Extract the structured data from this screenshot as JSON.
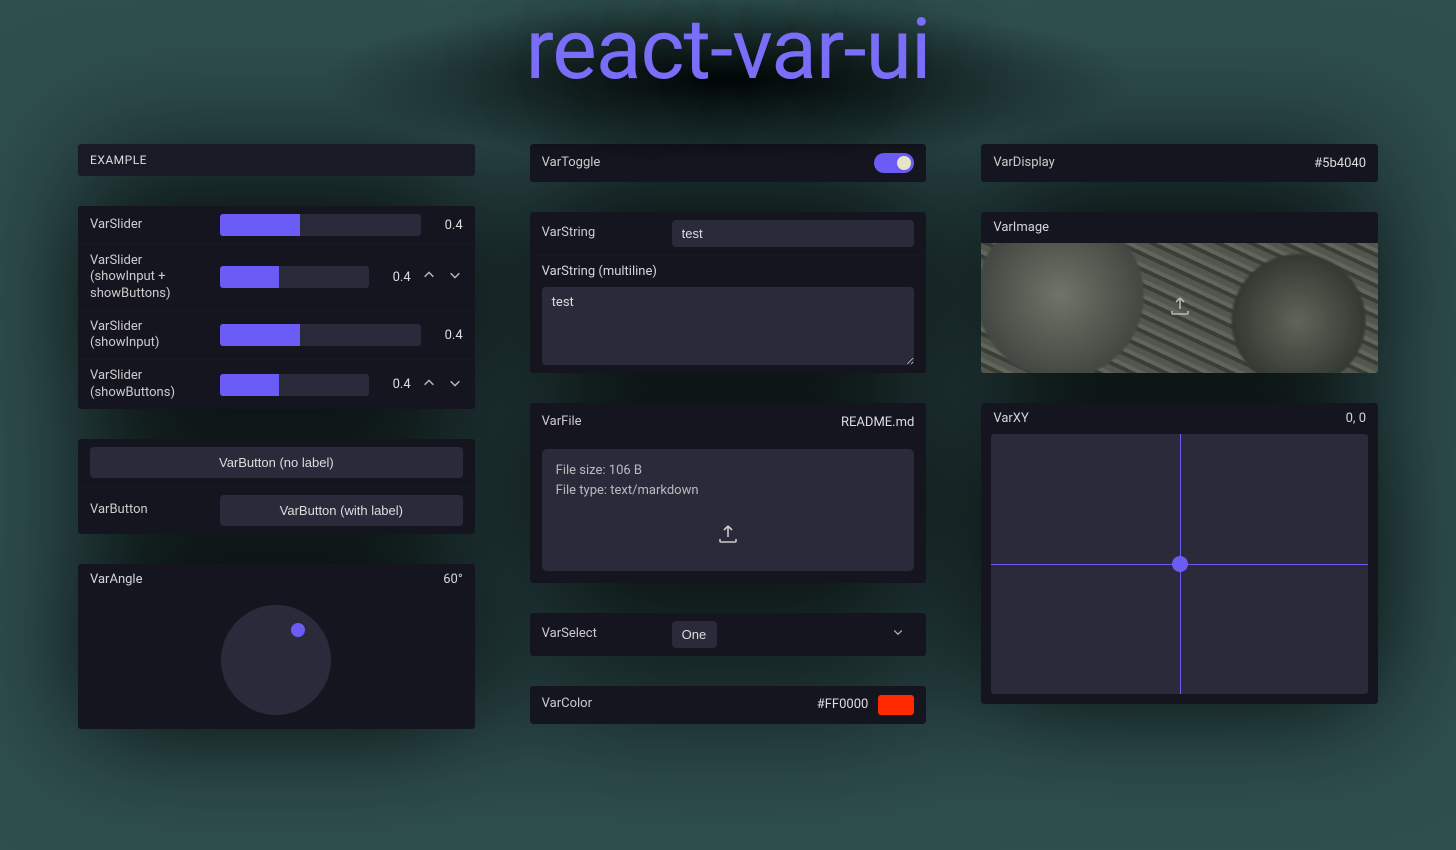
{
  "title": "react-var-ui",
  "colors": {
    "accent": "#6a5cf5",
    "bg_panel": "#15151f",
    "bg_input": "#2a2a3a"
  },
  "example_header": "EXAMPLE",
  "sliders": {
    "s1": {
      "label": "VarSlider",
      "value": "0.4"
    },
    "s2": {
      "label": "VarSlider (showInput + showButtons)",
      "value": "0.4"
    },
    "s3": {
      "label": "VarSlider (showInput)",
      "value": "0.4"
    },
    "s4": {
      "label": "VarSlider (showButtons)",
      "value": "0.4"
    }
  },
  "buttons": {
    "no_label": "VarButton (no label)",
    "with_label_label": "VarButton",
    "with_label_button": "VarButton (with label)"
  },
  "angle": {
    "label": "VarAngle",
    "value": "60°"
  },
  "toggle": {
    "label": "VarToggle",
    "value": true
  },
  "string": {
    "label": "VarString",
    "value": "test"
  },
  "string_multi": {
    "label": "VarString (multiline)",
    "value": "test"
  },
  "file": {
    "label": "VarFile",
    "name": "README.md",
    "size_line": "File size: 106 B",
    "type_line": "File type: text/markdown"
  },
  "select": {
    "label": "VarSelect",
    "value": "One"
  },
  "color": {
    "label": "VarColor",
    "value": "#FF0000"
  },
  "display": {
    "label": "VarDisplay",
    "value": "#5b4040"
  },
  "image": {
    "label": "VarImage"
  },
  "xy": {
    "label": "VarXY",
    "value": "0, 0"
  }
}
